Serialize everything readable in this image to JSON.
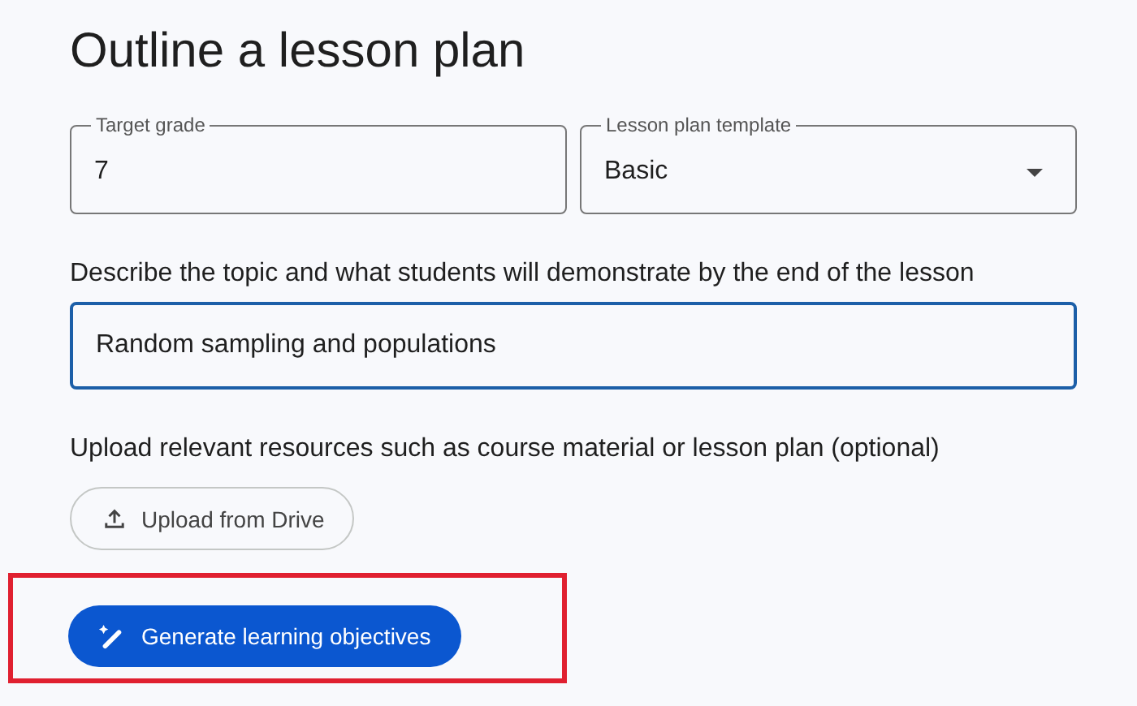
{
  "title": "Outline a lesson plan",
  "fields": [
    {
      "kind": "text",
      "label": "Target grade",
      "value": "7"
    },
    {
      "kind": "dropdown",
      "label": "Lesson plan template",
      "value": "Basic"
    }
  ],
  "topic": {
    "label": "Describe the topic and what students will demonstrate by the end of the lesson",
    "value": "Random sampling and populations",
    "focused": true
  },
  "upload": {
    "label": "Upload relevant resources such as course material or lesson plan (optional)",
    "button": "Upload from Drive"
  },
  "generate_button": {
    "label": "Generate learning objectives",
    "highlighted": true
  }
}
